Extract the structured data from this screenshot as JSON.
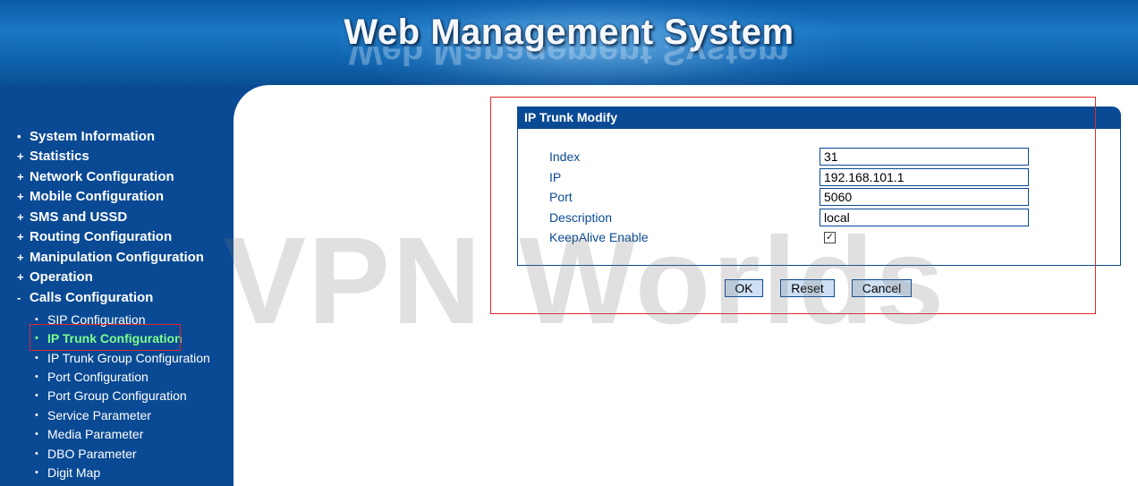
{
  "header": {
    "title": "Web Management System"
  },
  "sidebar": {
    "items": [
      {
        "label": "System Information",
        "bullet": "•"
      },
      {
        "label": "Statistics",
        "bullet": "+"
      },
      {
        "label": "Network Configuration",
        "bullet": "+"
      },
      {
        "label": "Mobile Configuration",
        "bullet": "+"
      },
      {
        "label": "SMS and USSD",
        "bullet": "+"
      },
      {
        "label": "Routing Configuration",
        "bullet": "+"
      },
      {
        "label": "Manipulation Configuration",
        "bullet": "+"
      },
      {
        "label": "Operation",
        "bullet": "+"
      },
      {
        "label": "Calls Configuration",
        "bullet": "-"
      }
    ],
    "sub_items": [
      {
        "label": "SIP Configuration",
        "active": false
      },
      {
        "label": "IP Trunk Configuration",
        "active": true
      },
      {
        "label": "IP Trunk Group Configuration",
        "active": false
      },
      {
        "label": "Port Configuration",
        "active": false
      },
      {
        "label": "Port Group Configuration",
        "active": false
      },
      {
        "label": "Service Parameter",
        "active": false
      },
      {
        "label": "Media Parameter",
        "active": false
      },
      {
        "label": "DBO Parameter",
        "active": false
      },
      {
        "label": "Digit Map",
        "active": false
      }
    ]
  },
  "panel": {
    "title": "IP Trunk Modify",
    "fields": {
      "index": {
        "label": "Index",
        "value": "31"
      },
      "ip": {
        "label": "IP",
        "value": "192.168.101.1"
      },
      "port": {
        "label": "Port",
        "value": "5060"
      },
      "description": {
        "label": "Description",
        "value": "local"
      },
      "keepalive": {
        "label": "KeepAlive Enable",
        "checked": true,
        "check_glyph": "✓"
      }
    }
  },
  "buttons": {
    "ok": "OK",
    "reset": "Reset",
    "cancel": "Cancel"
  },
  "watermark": "VPN Worlds",
  "colors": {
    "nav_bg": "#0a4a94",
    "active_item": "#7dff8a",
    "highlight": "#e0262c"
  }
}
